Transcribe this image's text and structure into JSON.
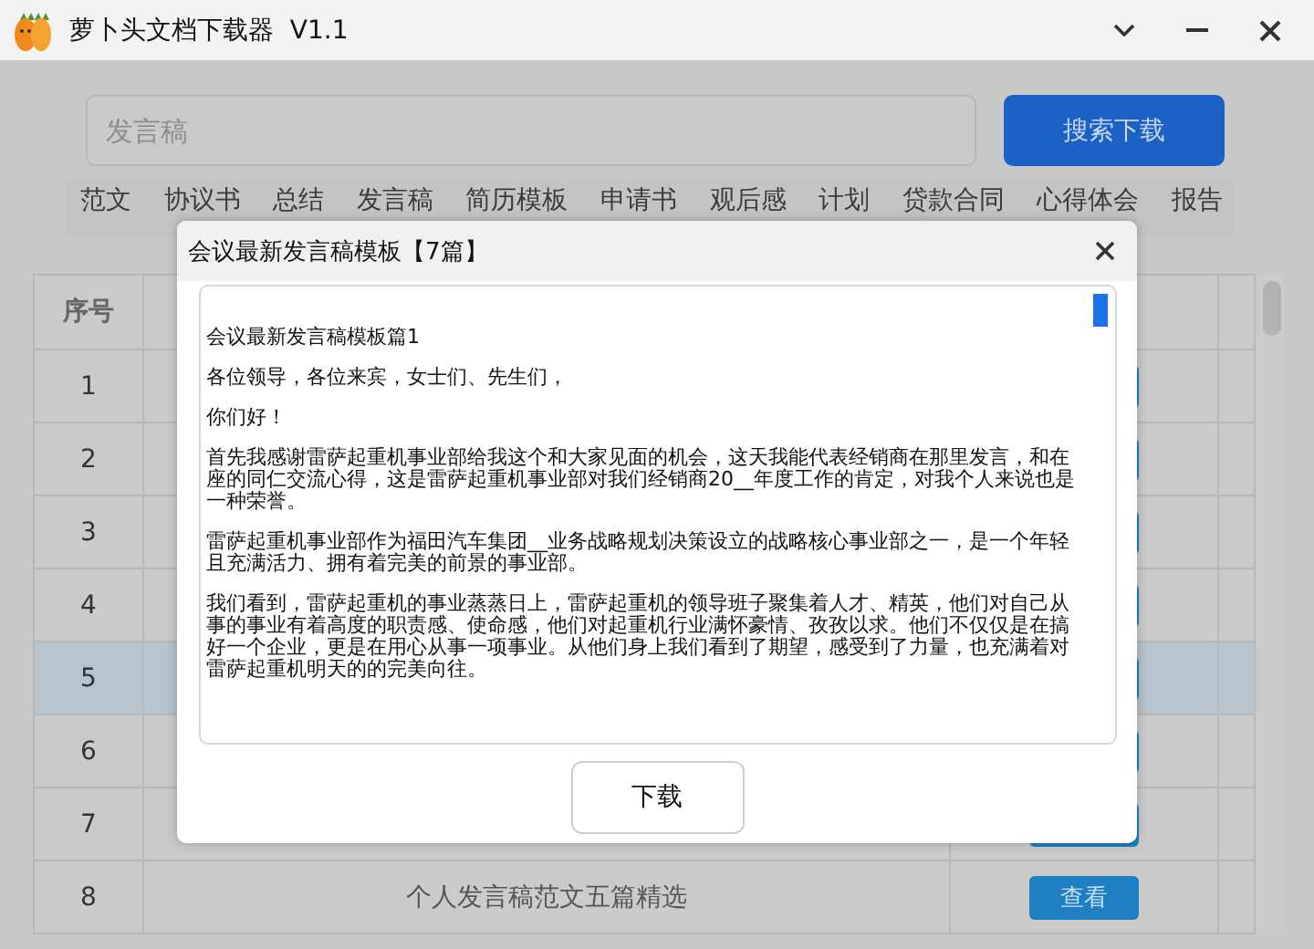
{
  "window": {
    "title": "萝卜头文档下载器  V1.1"
  },
  "search": {
    "placeholder": "发言稿",
    "button": "搜索下载"
  },
  "tabs": [
    {
      "label": "范文",
      "selected": false
    },
    {
      "label": "协议书",
      "selected": false
    },
    {
      "label": "总结",
      "selected": false
    },
    {
      "label": "发言稿",
      "selected": false
    },
    {
      "label": "简历模板",
      "selected": false
    },
    {
      "label": "申请书",
      "selected": false
    },
    {
      "label": "观后感",
      "selected": false
    },
    {
      "label": "计划",
      "selected": false
    },
    {
      "label": "贷款合同",
      "selected": false
    },
    {
      "label": "心得体会",
      "selected": false
    },
    {
      "label": "报告",
      "selected": false
    }
  ],
  "table": {
    "columns": [
      "序号"
    ],
    "rows": [
      {
        "no": "1",
        "selected": false
      },
      {
        "no": "2",
        "selected": false
      },
      {
        "no": "3",
        "selected": false
      },
      {
        "no": "4",
        "selected": false
      },
      {
        "no": "5",
        "selected": true
      },
      {
        "no": "6",
        "selected": false
      },
      {
        "no": "7",
        "selected": false
      },
      {
        "no": "8",
        "title": "个人发言稿范文五篇精选",
        "action": "查看",
        "selected": false
      }
    ]
  },
  "dialog": {
    "title": "会议最新发言稿模板【7篇】",
    "paragraphs": [
      "会议最新发言稿模板篇1",
      "各位领导，各位来宾，女士们、先生们，",
      "你们好！",
      "首先我感谢雷萨起重机事业部给我这个和大家见面的机会，这天我能代表经销商在那里发言，和在座的同仁交流心得，这是雷萨起重机事业部对我们经销商20__年度工作的肯定，对我个人来说也是一种荣誉。",
      "雷萨起重机事业部作为福田汽车集团__业务战略规划决策设立的战略核心事业部之一，是一个年轻且充满活力、拥有着完美的前景的事业部。",
      "我们看到，雷萨起重机的事业蒸蒸日上，雷萨起重机的领导班子聚集着人才、精英，他们对自己从事的事业有着高度的职责感、使命感，他们对起重机行业满怀豪情、孜孜以求。他们不仅仅是在搞好一个企业，更是在用心从事一项事业。从他们身上我们看到了期望，感受到了力量，也充满着对雷萨起重机明天的的完美向往。"
    ],
    "button": "下载"
  }
}
